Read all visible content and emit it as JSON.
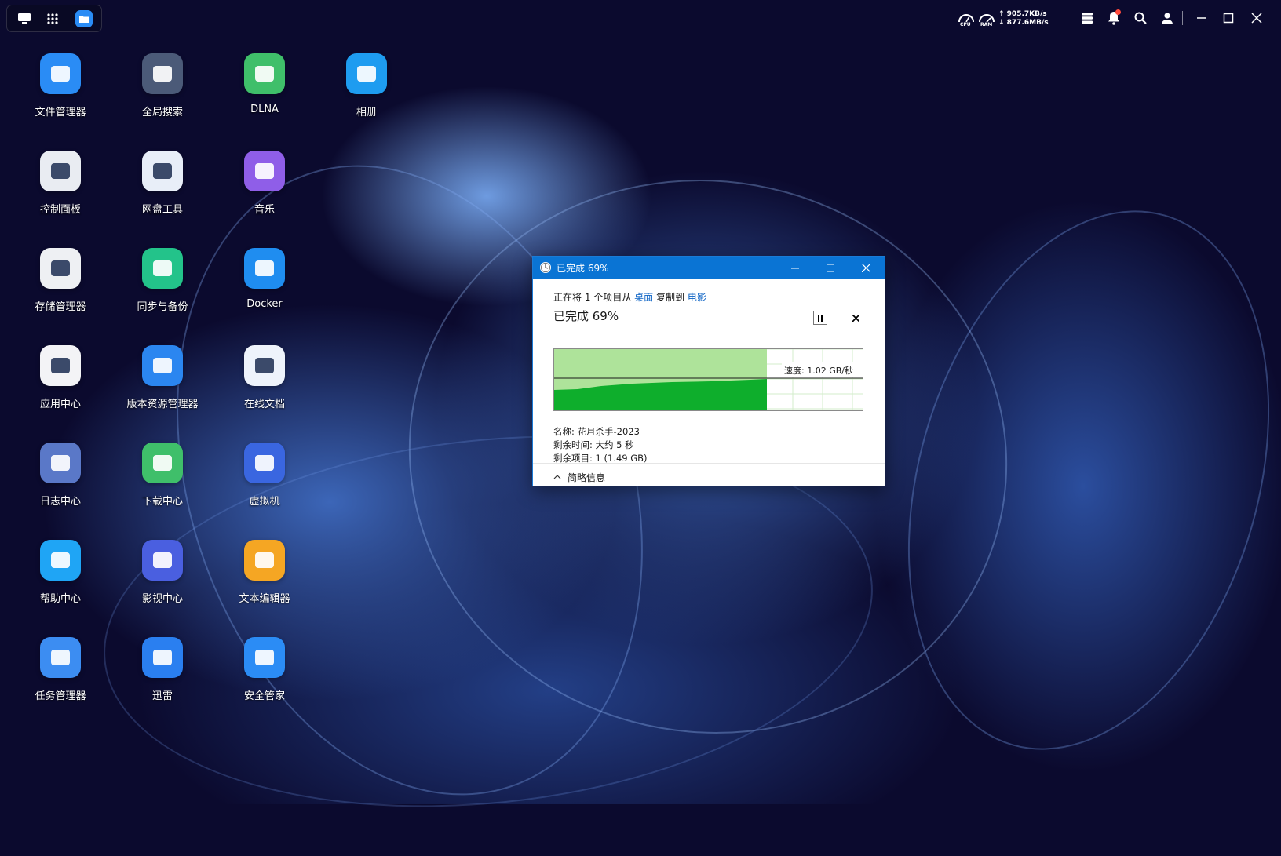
{
  "taskbar": {
    "upload_speed": "↑ 905.7KB/s",
    "download_speed": "↓ 877.6MB/s",
    "cpu_label": "CPU",
    "ram_label": "RAM"
  },
  "desktop": {
    "apps": [
      {
        "label": "文件管理器",
        "icon": "folder-icon",
        "color": "#2a8cf5"
      },
      {
        "label": "全局搜索",
        "icon": "search-list-icon",
        "color": "#4b5a78"
      },
      {
        "label": "DLNA",
        "icon": "dlna-icon",
        "color": "#3fbf6a"
      },
      {
        "label": "相册",
        "icon": "photo-icon",
        "color": "#1e9cf0"
      },
      {
        "label": "控制面板",
        "icon": "sliders-icon",
        "color": "#e9ecf2"
      },
      {
        "label": "网盘工具",
        "icon": "cloud-drive-icon",
        "color": "#e8eef8"
      },
      {
        "label": "音乐",
        "icon": "music-icon",
        "color": "#8f5ee8"
      },
      {
        "label": "存储管理器",
        "icon": "storage-icon",
        "color": "#eef0f3"
      },
      {
        "label": "同步与备份",
        "icon": "sync-icon",
        "color": "#23c38a"
      },
      {
        "label": "Docker",
        "icon": "docker-icon",
        "color": "#1f8df0"
      },
      {
        "label": "应用中心",
        "icon": "app-center-icon",
        "color": "#f3f3f6"
      },
      {
        "label": "版本资源管理器",
        "icon": "version-icon",
        "color": "#2b86f0"
      },
      {
        "label": "在线文档",
        "icon": "online-doc-icon",
        "color": "#eef3fb"
      },
      {
        "label": "日志中心",
        "icon": "log-icon",
        "color": "#5a78c8"
      },
      {
        "label": "下载中心",
        "icon": "download-icon",
        "color": "#3fbf6a"
      },
      {
        "label": "虚拟机",
        "icon": "vm-icon",
        "color": "#3a66e0"
      },
      {
        "label": "帮助中心",
        "icon": "lightbulb-icon",
        "color": "#1fa5f5"
      },
      {
        "label": "影视中心",
        "icon": "video-icon",
        "color": "#4a5fe0"
      },
      {
        "label": "文本编辑器",
        "icon": "text-editor-icon",
        "color": "#f5a623"
      },
      {
        "label": "任务管理器",
        "icon": "task-manager-icon",
        "color": "#3c8df2"
      },
      {
        "label": "迅雷",
        "icon": "xunlei-icon",
        "color": "#2a7ff0"
      },
      {
        "label": "安全管家",
        "icon": "shield-icon",
        "color": "#2b8cf5"
      }
    ]
  },
  "dialog": {
    "title": "已完成 69%",
    "progress_fraction": 0.69,
    "line1_prefix": "正在将",
    "line1_count": "1",
    "line1_mid": "个项目从",
    "source": "桌面",
    "line1_copy": "复制到",
    "dest": "电影",
    "status": "已完成 69%",
    "speed": "速度: 1.02 GB/秒",
    "name": "名称: 花月杀手-2023",
    "time_left": "剩余时间: 大约 5 秒",
    "items_left": "剩余项目: 1 (1.49 GB)",
    "details_toggle": "简略信息"
  }
}
